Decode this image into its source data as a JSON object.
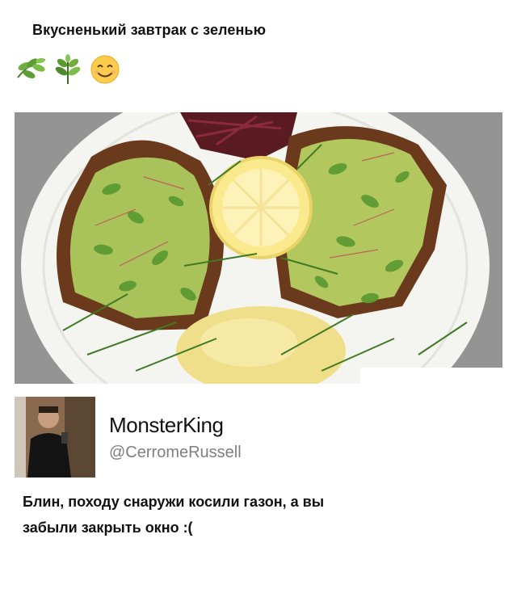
{
  "post": {
    "title": "Вкусненький завтрак с зеленью",
    "emojis": [
      "herb-icon",
      "herb-icon",
      "smiling-face-icon"
    ]
  },
  "photo": {
    "subject": "avocado-toast-with-microgreens"
  },
  "tweet": {
    "author_name": "MonsterKing",
    "author_handle": "@CerromeRussell",
    "text_line1": "Блин, походу снаружи косили газон, а вы",
    "text_line2": "забыли закрыть окно :("
  },
  "colors": {
    "background": "#ffffff",
    "text": "#111111",
    "handle": "#7f7f7f",
    "avocado": "#a9c25a",
    "greens": "#4e8a2c",
    "plate": "#f4f4f1",
    "stone": "#8e8e8e"
  }
}
